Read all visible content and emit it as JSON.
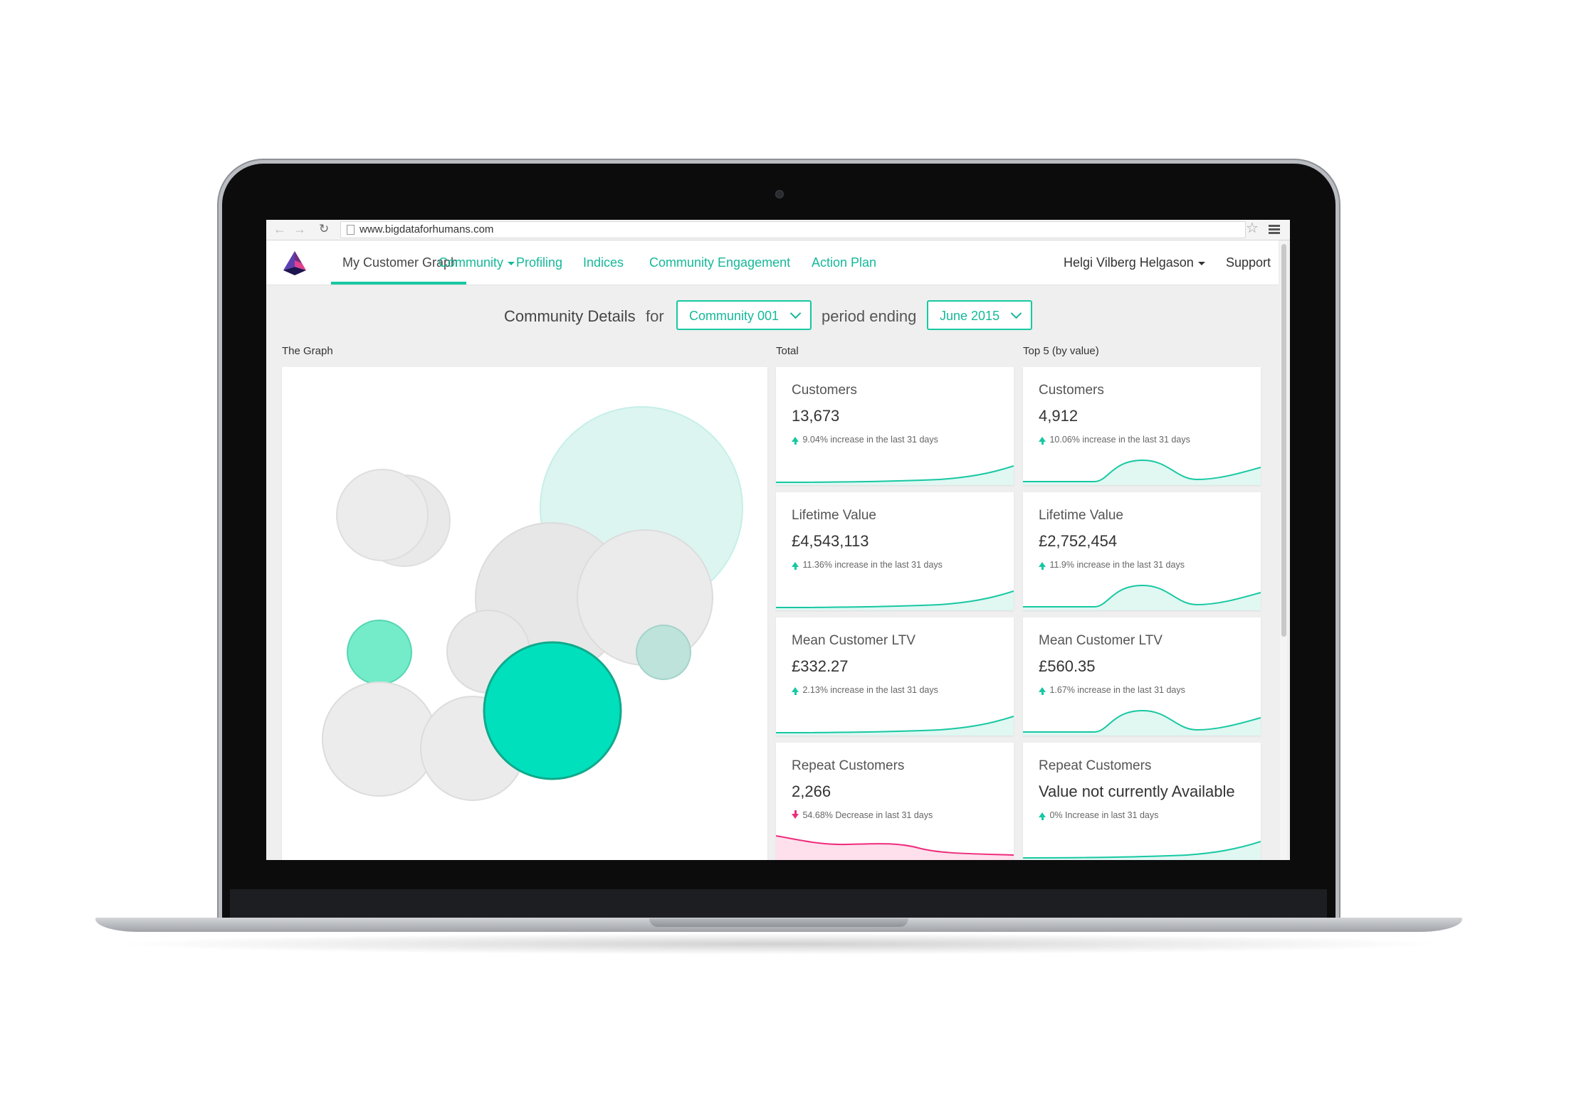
{
  "browser": {
    "url": "www.bigdataforhumans.com",
    "back_icon": "back-arrow-icon",
    "forward_icon": "forward-arrow-icon",
    "reload_icon": "reload-icon",
    "bookmark_icon": "star-icon",
    "menu_icon": "hamburger-menu-icon"
  },
  "nav": {
    "items": [
      {
        "label": "My Customer Graph",
        "active": true
      },
      {
        "label": "Community",
        "has_dropdown": true
      },
      {
        "label": "Profiling"
      },
      {
        "label": "Indices"
      },
      {
        "label": "Community Engagement"
      },
      {
        "label": "Action Plan"
      }
    ],
    "user": "Helgi Vilberg Helgason",
    "support": "Support"
  },
  "filter": {
    "title": "Community Details",
    "for": "for",
    "community": "Community 001",
    "period_label": "period ending",
    "period": "June 2015"
  },
  "sections": {
    "graph": "The Graph",
    "total": "Total",
    "top5": "Top 5 (by value)"
  },
  "colors": {
    "accent": "#16c8a2",
    "accent_dark": "#16b89a",
    "negative": "#ef2c7c",
    "bubble_grey": "#eaeaea",
    "bubble_highlight": "#00e0bd"
  },
  "total_cards": [
    {
      "title": "Customers",
      "value": "13,673",
      "trend": "9.04% increase in the last 31 days",
      "direction": "up"
    },
    {
      "title": "Lifetime Value",
      "value": "£4,543,113",
      "trend": "11.36% increase in the last 31 days",
      "direction": "up"
    },
    {
      "title": "Mean Customer LTV",
      "value": "£332.27",
      "trend": "2.13% increase in the last 31 days",
      "direction": "up"
    },
    {
      "title": "Repeat Customers",
      "value": "2,266",
      "trend": "54.68% Decrease in last 31 days",
      "direction": "down"
    }
  ],
  "top5_cards": [
    {
      "title": "Customers",
      "value": "4,912",
      "trend": "10.06% increase in the last 31 days",
      "direction": "up"
    },
    {
      "title": "Lifetime Value",
      "value": "£2,752,454",
      "trend": "11.9% increase in the last 31 days",
      "direction": "up"
    },
    {
      "title": "Mean Customer LTV",
      "value": "£560.35",
      "trend": "1.67% increase in the last 31 days",
      "direction": "up"
    },
    {
      "title": "Repeat Customers",
      "value": "Value not currently Available",
      "trend": "0% Increase in last 31 days",
      "direction": "up"
    }
  ]
}
